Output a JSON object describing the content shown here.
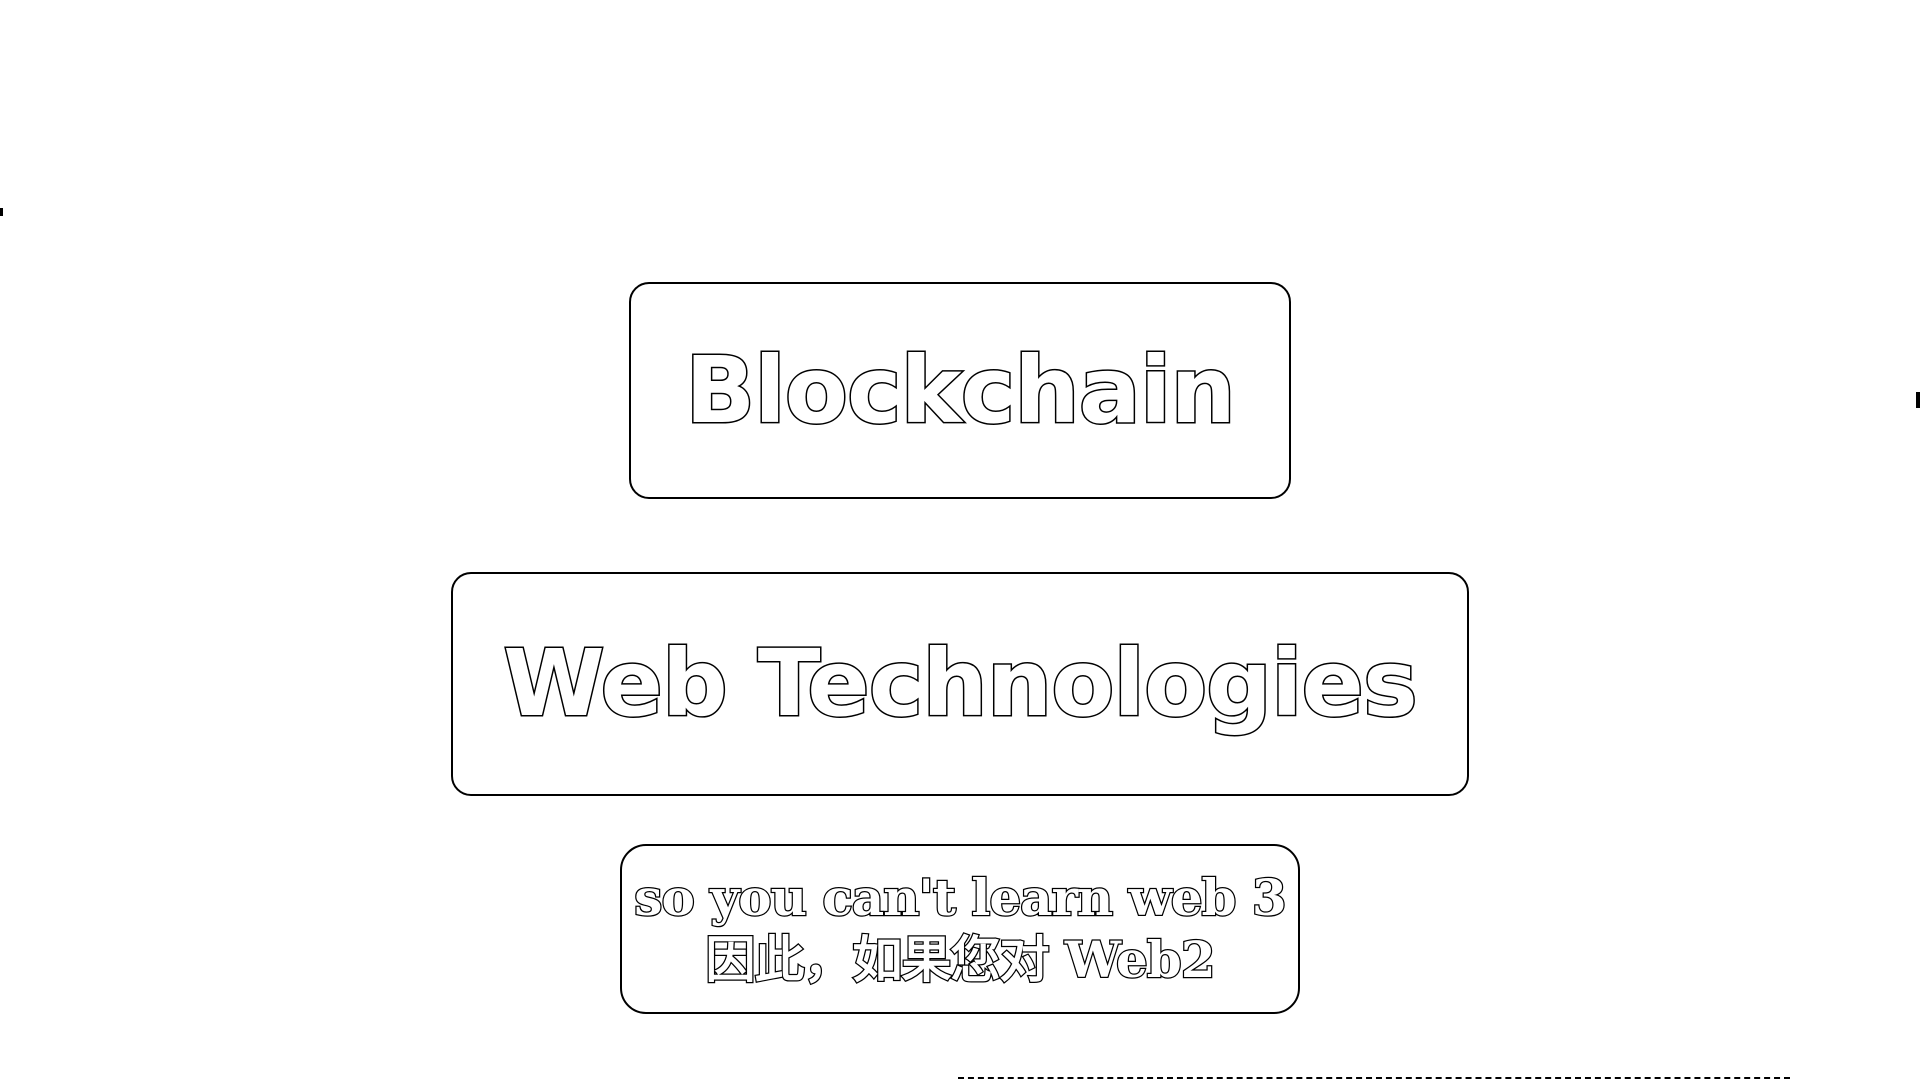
{
  "cards": {
    "blockchain": {
      "label": "Blockchain"
    },
    "web_technologies": {
      "label": "Web Technologies"
    }
  },
  "subtitle": {
    "line_en": "so you can't learn web 3",
    "line_zh": "因此，如果您对 Web2"
  },
  "colors": {
    "background": "#ffffff",
    "outline": "#000000",
    "text_fill": "#ffffff"
  }
}
